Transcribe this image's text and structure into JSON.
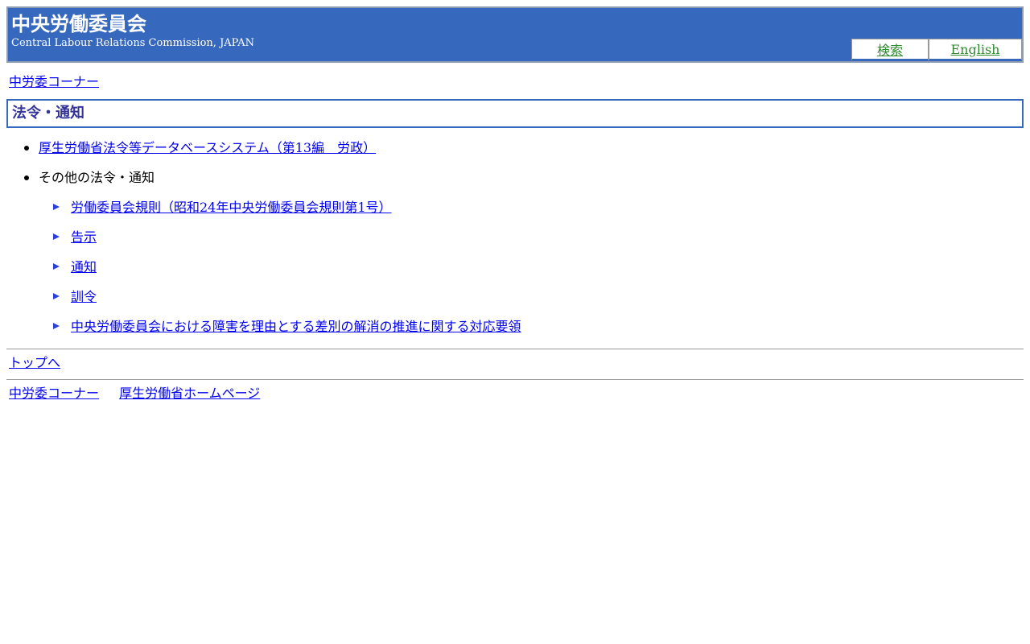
{
  "header": {
    "title": "中央労働委員会",
    "subtitle": "Central Labour Relations Commission, JAPAN",
    "tabs": [
      {
        "label": "検索"
      },
      {
        "label": "English"
      }
    ]
  },
  "breadcrumb": {
    "label": "中労委コーナー"
  },
  "section": {
    "title": "法令・通知"
  },
  "list": {
    "items": [
      {
        "label": "厚生労働省法令等データベースシステム（第13編　労政）",
        "link": true
      },
      {
        "label": "その他の法令・通知",
        "link": false
      }
    ],
    "subitems": [
      {
        "label": "労働委員会規則（昭和24年中央労働委員会規則第1号）"
      },
      {
        "label": "告示"
      },
      {
        "label": "通知"
      },
      {
        "label": "訓令"
      },
      {
        "label": "中央労働委員会における障害を理由とする差別の解消の推進に関する対応要領"
      }
    ]
  },
  "back_to_top": {
    "label": "トップへ"
  },
  "footer": {
    "links": [
      {
        "label": "中労委コーナー"
      },
      {
        "label": "厚生労働省ホームページ"
      }
    ]
  },
  "colors": {
    "header_bg": "#3668bd",
    "heading_text": "#333399",
    "tab_link": "#2e8b2e",
    "link": "#0000ee"
  }
}
